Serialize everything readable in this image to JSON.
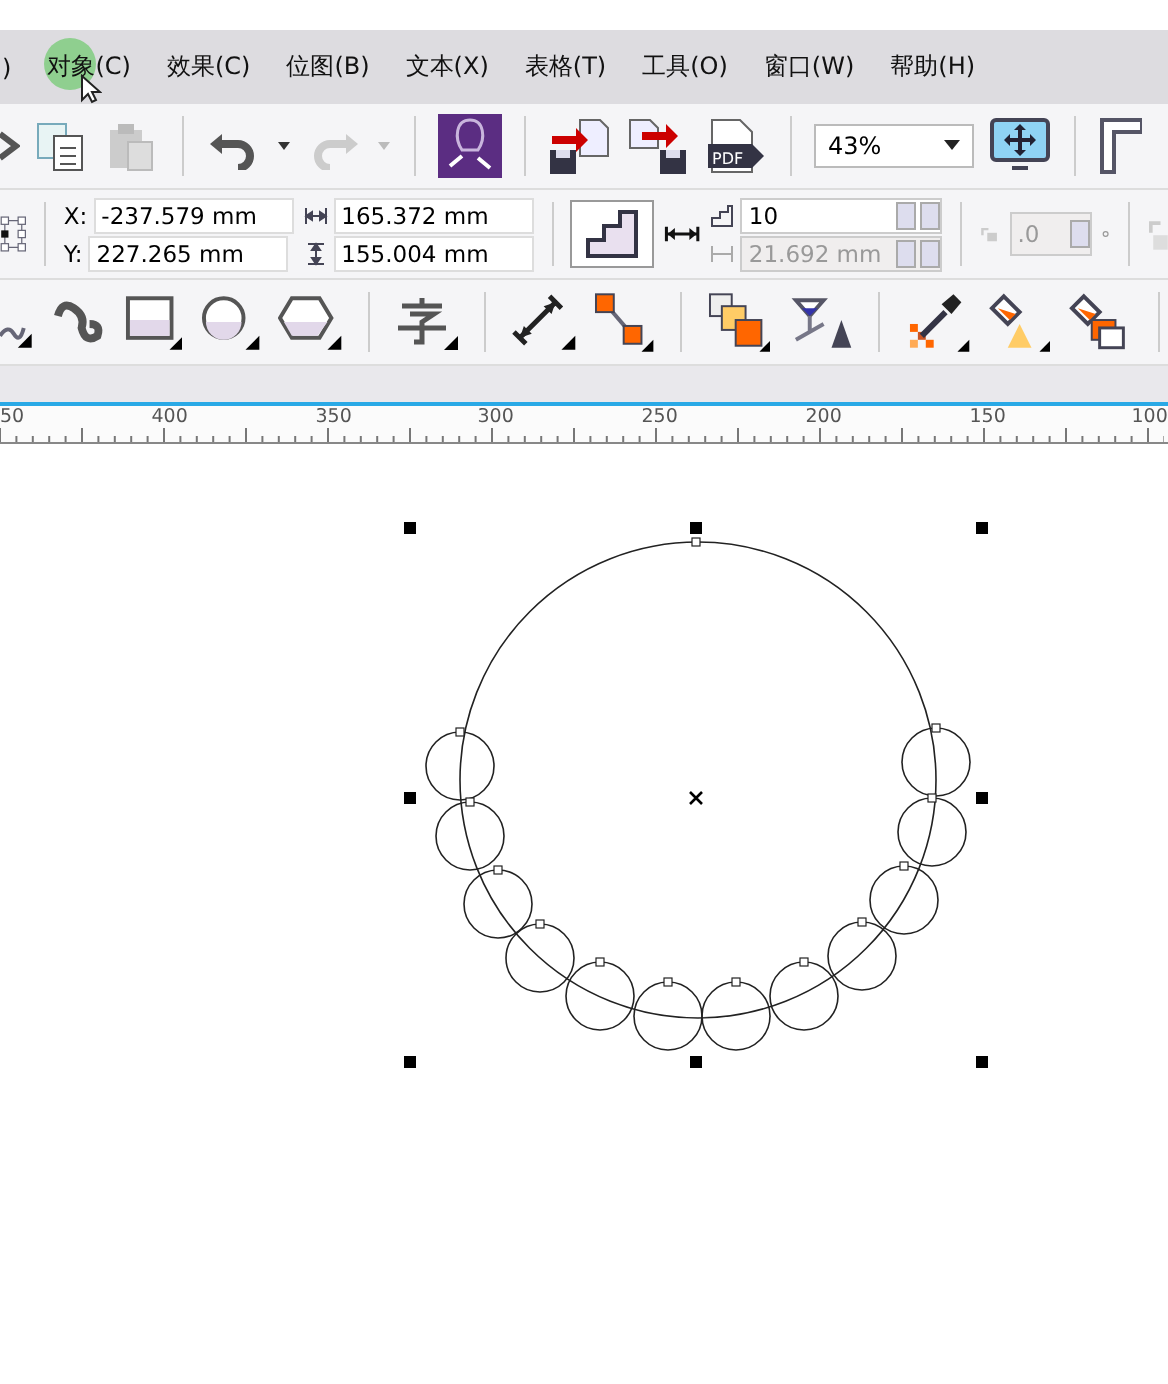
{
  "menu_bar": {
    "items": [
      ")",
      "对象(C)",
      "效果(C)",
      "位图(B)",
      "文本(X)",
      "表格(T)",
      "工具(O)",
      "窗口(W)",
      "帮助(H)"
    ]
  },
  "standard_toolbar": {
    "pdf_icon_label": "PDF",
    "zoom_level": "43%"
  },
  "property_bar": {
    "x_label": "X:",
    "x_value": "-237.579 mm",
    "y_label": "Y:",
    "y_value": "227.265 mm",
    "width_value": "165.372 mm",
    "height_value": "155.004 mm",
    "steps": {
      "value": "10",
      "disabled": false
    },
    "spacing": {
      "value": "21.692 mm",
      "disabled": true
    },
    "rotation": {
      "value": ".0",
      "disabled": true
    }
  },
  "ruler": {
    "labels": [
      "50",
      "400",
      "350",
      "300",
      "250",
      "200",
      "150",
      "100"
    ]
  }
}
